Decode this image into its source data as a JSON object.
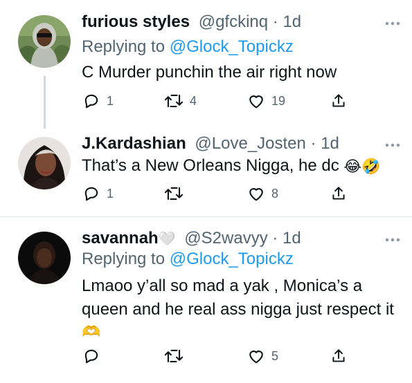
{
  "tweets": [
    {
      "name": "furious styles",
      "handle": "@gfckinq",
      "time": "1d",
      "replying_prefix": "Replying to ",
      "replying_handle": "@Glock_Topickz",
      "text": "C Murder punchin the air right now",
      "replies": "1",
      "retweets": "4",
      "likes": "19"
    },
    {
      "name": "J.Kardashian",
      "handle": "@Love_Josten",
      "time": "1d",
      "text": "That’s a New Orleans Nigga, he dc",
      "text_emoji": "😂🤣",
      "replies": "1",
      "retweets": "",
      "likes": "8"
    },
    {
      "name": "savannah",
      "name_emoji": "🤍",
      "handle": "@S2wavyy",
      "time": "1d",
      "replying_prefix": "Replying to ",
      "replying_handle": "@Glock_Topickz",
      "text_line1": "Lmaoo y’all so mad a yak , Monica’s a",
      "text_line2": "queen and he real ass nigga just respect it",
      "text_emoji": "🫶",
      "replies": "",
      "retweets": "",
      "likes": "5"
    }
  ],
  "separator": " · ",
  "colors": {
    "text": "#0f1419",
    "muted": "#536471",
    "link": "#1d9bf0",
    "divider": "#e1e8ed",
    "thread_line": "#cfd9de"
  },
  "icons": [
    "reply-icon",
    "retweet-icon",
    "like-icon",
    "share-icon",
    "more-icon"
  ]
}
